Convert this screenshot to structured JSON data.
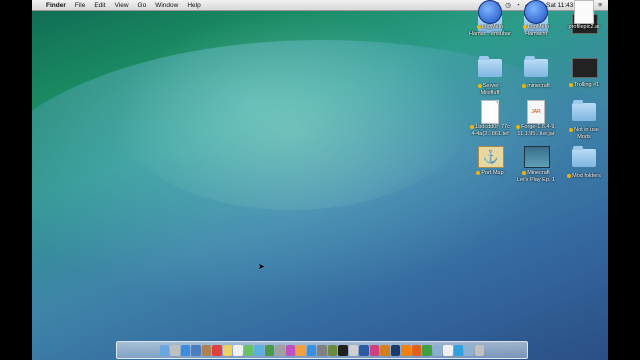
{
  "menubar": {
    "apple": "",
    "app": "Finder",
    "menus": [
      "File",
      "Edit",
      "View",
      "Go",
      "Window",
      "Help"
    ],
    "time": "Sat 11:43 AM"
  },
  "desktop_icons": [
    {
      "label1": "",
      "label2": "",
      "kind": "folder",
      "tag": false
    },
    {
      "label1": "",
      "label2": "",
      "kind": "folder",
      "tag": false
    },
    {
      "label1": "",
      "label2": "",
      "kind": "term",
      "tag": false
    },
    {
      "label1": "Server -",
      "label2": "Minifluff",
      "kind": "folder",
      "tag": true
    },
    {
      "label1": "minecraft",
      "label2": "",
      "kind": "folder",
      "tag": true
    },
    {
      "label1": "Trolling #1",
      "label2": "",
      "kind": "term",
      "tag": true
    },
    {
      "label1": "1bdcdd0f~77c",
      "label2": "4-4a(2...861.tef",
      "kind": "doc",
      "tag": true
    },
    {
      "label1": "Forge-1.6.4-9.",
      "label2": "11.1.95...iler.jar",
      "kind": "jar",
      "tag": true
    },
    {
      "label1": "Not in use",
      "label2": "Mods",
      "kind": "folder",
      "tag": true
    },
    {
      "label1": "Port Map",
      "label2": "",
      "kind": "anchor",
      "tag": true
    },
    {
      "label1": "Minecraft",
      "label2": "Let's Play Ep. 1",
      "kind": "movie",
      "tag": true
    },
    {
      "label1": "Mod folders",
      "label2": "",
      "kind": "folder",
      "tag": true
    },
    {
      "label1": "LogMeIn",
      "label2": "Hamac...ensubar",
      "kind": "logmein",
      "tag": true
    },
    {
      "label1": "LogMeIn",
      "label2": "Hamachi",
      "kind": "logmein",
      "tag": true
    },
    {
      "label1": "profilepic2.ai",
      "label2": "",
      "kind": "ai",
      "tag": false
    }
  ],
  "dock": {
    "items": [
      "finder",
      "launchpad",
      "safari",
      "mail",
      "contacts",
      "calendar",
      "notes",
      "reminders",
      "maps",
      "messages",
      "facetime",
      "photo",
      "itunes",
      "ibooks",
      "appstore",
      "prefs",
      "minecraft",
      "terminal",
      "chess",
      "photoshop",
      "indesign",
      "illustrator",
      "photoshop2",
      "vlc",
      "firefox",
      "chrome",
      "preview",
      "textedit",
      "skype",
      "folder",
      "trash"
    ],
    "colors": [
      "#6aa6e0",
      "#c0c0c0",
      "#3b8be0",
      "#4a7ec0",
      "#b08050",
      "#e04040",
      "#f0d060",
      "#f0f0f0",
      "#6ac06a",
      "#5ab0e0",
      "#4a9a4a",
      "#a0a0a0",
      "#c050c0",
      "#f0a040",
      "#3a90e0",
      "#808080",
      "#6a8a40",
      "#202020",
      "#d0d0d0",
      "#2a5aa0",
      "#d04080",
      "#d08020",
      "#1a3a6a",
      "#f08010",
      "#e06020",
      "#40a040",
      "#8ab0d0",
      "#f0f0f0",
      "#30a0e0",
      "#90b0d0",
      "#c0c0c0"
    ]
  }
}
